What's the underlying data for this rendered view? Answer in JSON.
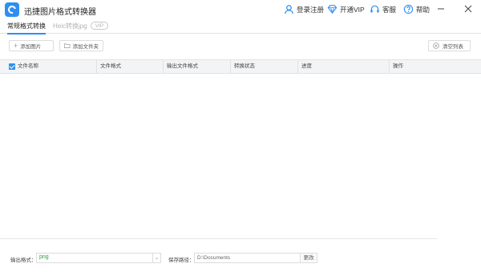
{
  "app": {
    "title": "迅捷图片格式转换器"
  },
  "titlebar": {
    "login_label": "登录注册",
    "vip_label": "开通VIP",
    "service_label": "客服",
    "help_label": "帮助"
  },
  "tabs": [
    {
      "label": "常规格式转换"
    },
    {
      "label": "Heic转换jpg",
      "badge": "VIP"
    }
  ],
  "toolbar": {
    "add_image_label": "添加图片",
    "add_folder_label": "添加文件夹",
    "clear_list_label": "清空列表"
  },
  "table": {
    "columns": [
      "文件名称",
      "文件格式",
      "输出文件格式",
      "转换状态",
      "进度",
      "操作"
    ]
  },
  "bottom": {
    "format_label": "输出格式：",
    "format_value": "png",
    "path_label": "保存路径：",
    "path_value": "D:\\Documents",
    "change_label": "更改"
  },
  "colors": {
    "accent": "#2f8ff0",
    "format_value": "#2a9d3a"
  }
}
